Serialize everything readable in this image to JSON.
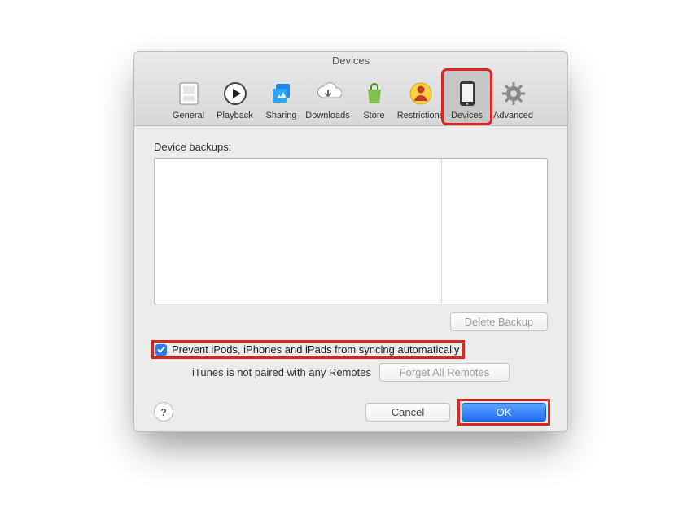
{
  "window": {
    "title": "Devices"
  },
  "tabs": {
    "general": {
      "label": "General"
    },
    "playback": {
      "label": "Playback"
    },
    "sharing": {
      "label": "Sharing"
    },
    "downloads": {
      "label": "Downloads"
    },
    "store": {
      "label": "Store"
    },
    "restrictions": {
      "label": "Restrictions"
    },
    "devices": {
      "label": "Devices"
    },
    "advanced": {
      "label": "Advanced"
    }
  },
  "body": {
    "backups_label": "Device backups:",
    "delete_backup": "Delete Backup",
    "prevent_sync": "Prevent iPods, iPhones and iPads from syncing automatically",
    "prevent_sync_checked": true,
    "remotes_text": "iTunes is not paired with any Remotes",
    "forget_remotes": "Forget All Remotes"
  },
  "footer": {
    "help": "?",
    "cancel": "Cancel",
    "ok": "OK"
  }
}
